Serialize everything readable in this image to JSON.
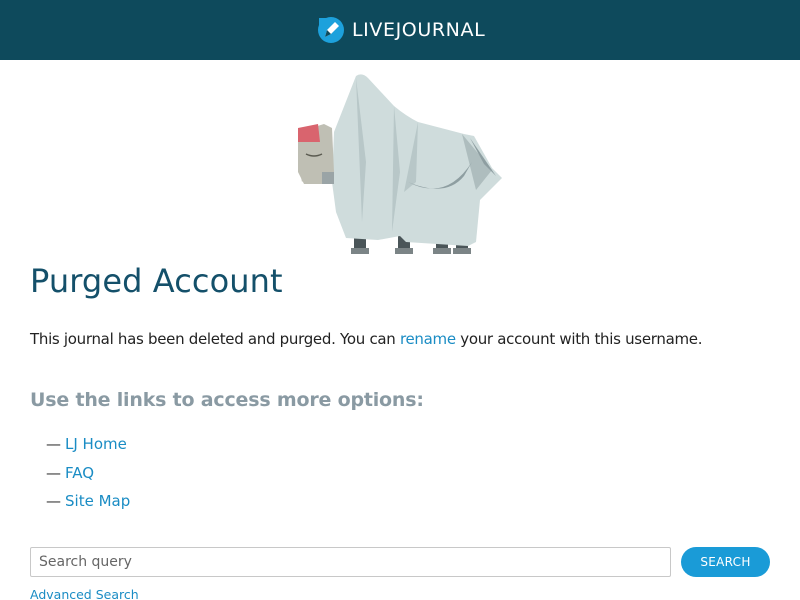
{
  "header": {
    "logo_text": "LIVEJOURNAL",
    "logo_icon": "livejournal-pencil-icon",
    "background_color": "#0e4a5c"
  },
  "illustration": {
    "name": "ghost-yak-illustration"
  },
  "main": {
    "title": "Purged Account",
    "description": {
      "before": "This journal has been deleted and purged. You can ",
      "link": "rename",
      "after": " your account with this username."
    },
    "subtitle": "Use the links to access more options:",
    "links": [
      {
        "dash": "—",
        "label": "LJ Home"
      },
      {
        "dash": "—",
        "label": "FAQ"
      },
      {
        "dash": "—",
        "label": "Site Map"
      }
    ]
  },
  "search": {
    "placeholder": "Search query",
    "button_label": "SEARCH",
    "advanced_label": "Advanced Search"
  },
  "colors": {
    "title": "#14506a",
    "link": "#1a8cc4",
    "button": "#1a9bd7",
    "subtitle": "#8a9aa3"
  }
}
